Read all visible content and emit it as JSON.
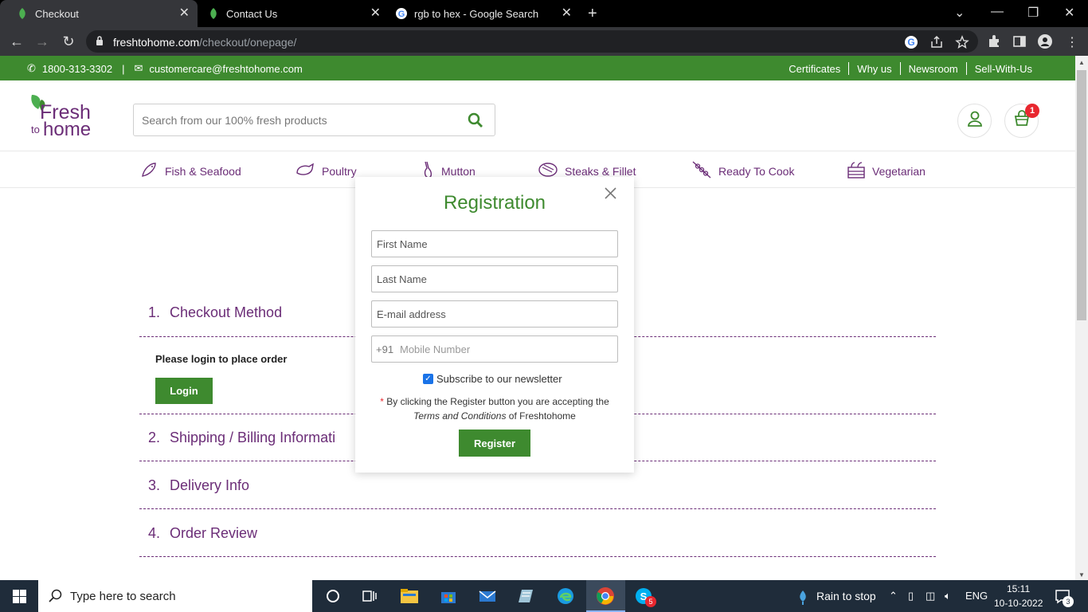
{
  "browser": {
    "tabs": [
      {
        "title": "Checkout",
        "active": true
      },
      {
        "title": "Contact Us",
        "active": false
      },
      {
        "title": "rgb to hex - Google Search",
        "active": false
      }
    ],
    "url_domain": "freshtohome.com",
    "url_path": "/checkout/onepage/"
  },
  "topbar": {
    "phone": "1800-313-3302",
    "email": "customercare@freshtohome.com",
    "links": [
      "Certificates",
      "Why us",
      "Newsroom",
      "Sell-With-Us"
    ]
  },
  "header": {
    "logo": {
      "word1": "Fresh",
      "word2": "to",
      "word3": "home"
    },
    "search_placeholder": "Search from our 100% fresh products",
    "cart_count": "1"
  },
  "categories": [
    "Fish & Seafood",
    "Poultry",
    "Mutton",
    "Steaks & Fillet",
    "Ready To Cook",
    "Vegetarian"
  ],
  "checkout": {
    "steps": [
      {
        "num": "1.",
        "name": "Checkout Method"
      },
      {
        "num": "2.",
        "name": "Shipping / Billing Informati"
      },
      {
        "num": "3.",
        "name": "Delivery Info"
      },
      {
        "num": "4.",
        "name": "Order Review"
      }
    ],
    "login_message": "Please login to place order",
    "login_button": "Login"
  },
  "modal": {
    "title": "Registration",
    "first_name_placeholder": "First Name",
    "last_name_placeholder": "Last Name",
    "email_placeholder": "E-mail address",
    "country_code": "+91",
    "mobile_placeholder": "Mobile Number",
    "newsletter_label": "Subscribe to our newsletter",
    "newsletter_checked": true,
    "terms_prefix": "By clicking the Register button you are accepting the",
    "terms_link": "Terms and Conditions",
    "terms_suffix": "of Freshtohome",
    "register_button": "Register"
  },
  "taskbar": {
    "search_placeholder": "Type here to search",
    "weather": "Rain to stop",
    "language": "ENG",
    "time": "15:11",
    "date": "10-10-2022",
    "notifications": "3",
    "skype_badge": "5"
  },
  "colors": {
    "brand_green": "#3e8a2f",
    "brand_purple": "#6b2d77",
    "badge_red": "#e8272f"
  }
}
